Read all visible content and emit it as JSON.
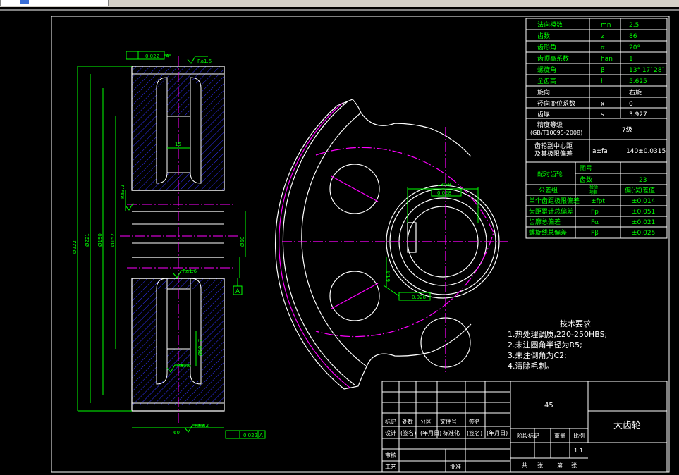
{
  "params": [
    {
      "name": "法向模数",
      "sym": "mn",
      "val": "2.5"
    },
    {
      "name": "齿数",
      "sym": "z",
      "val": "86"
    },
    {
      "name": "齿形角",
      "sym": "α",
      "val": "20°"
    },
    {
      "name": "齿顶高系数",
      "sym": "han",
      "val": "1"
    },
    {
      "name": "螺旋角",
      "sym": "β",
      "val": "13° 17′ 28″"
    },
    {
      "name": "全齿高",
      "sym": "h",
      "val": "5.625"
    },
    {
      "name": "旋向",
      "sym": "",
      "val": "右旋"
    },
    {
      "name": "径向变位系数",
      "sym": "x",
      "val": "0"
    },
    {
      "name": "齿厚",
      "sym": "s",
      "val": "3.927"
    }
  ],
  "accuracy": {
    "label1": "精度等级",
    "label2": "(GB/T10095-2008)",
    "val": "7级"
  },
  "center": {
    "label1": "齿轮副中心距",
    "label2": "及其极限偏差",
    "sym": "a±fa",
    "val": "140±0.0315"
  },
  "mating": {
    "label": "配对齿轮",
    "row1": "图号",
    "row2": "齿数",
    "row2val": "23"
  },
  "tol_head": {
    "label": "公差组",
    "sym1": "检验",
    "sym2": "项目",
    "val": "偏(误)差值"
  },
  "tolerances": [
    {
      "name": "单个齿距极限偏差",
      "sym": "±fpt",
      "val": "±0.014"
    },
    {
      "name": "齿距累计总偏差",
      "sym": "Fp",
      "val": "±0.051"
    },
    {
      "name": "齿廓总偏差",
      "sym": "Fα",
      "val": "±0.021"
    },
    {
      "name": "螺旋线总偏差",
      "sym": "Fβ",
      "val": "±0.025"
    }
  ],
  "tech": {
    "title": "技术要求",
    "items": [
      "1.热处理调质,220-250HBS;",
      "2.未注圆角半径为R5;",
      "3.未注倒角为C2;",
      "4.清除毛刺。"
    ]
  },
  "title_block": {
    "material": "45",
    "part_name": "大齿轮",
    "r_biaoji": "标记",
    "r_chushu": "处数",
    "r_fenqu": "分区",
    "r_wenjian": "文件号",
    "r_qianming": "签名",
    "r_sheji": "设计",
    "r_qianming2": "(签名)",
    "r_date": "(年月日)",
    "r_biaozhunhua": "标准化",
    "r_qianming3": "(签名)",
    "r_date2": "(年月日)",
    "r_jieduan": "阶段标记",
    "r_zhongliang": "重量",
    "r_bili": "比例",
    "r_ratio": "1:1",
    "r_shenhe": "审核",
    "r_gongyi": "工艺",
    "r_pizhun": "批准",
    "r_gong": "共",
    "r_zhang": "张",
    "r_di": "第",
    "r_zhang2": "张"
  },
  "dims": {
    "gtol_top": "0.022",
    "datum": "A",
    "ra_top": "Ra1.6",
    "ra_mid": "Ra1.6",
    "ra_low": "Ra1.6",
    "ra_bot": "Ra3.2",
    "d_outer": "Ø222",
    "d_tip": "Ø221",
    "d_root": "Ø190",
    "d_hub": "Ø152",
    "d_bore": "Ø60",
    "d_bore2": "Ø80",
    "w_web": "15",
    "w_face": "60",
    "w_keyhub": "Ø60H7",
    "ra_left": "Ra3.2",
    "w_key": "18",
    "h_key": "64.4",
    "key_tol": "0.028",
    "gtol_bot": "0.022",
    "w_keyslot": "18JS9"
  },
  "colors": {
    "line": "#ffffff",
    "dim": "#00ff00",
    "hatch": "#3333ff",
    "center": "#ff00ff"
  }
}
